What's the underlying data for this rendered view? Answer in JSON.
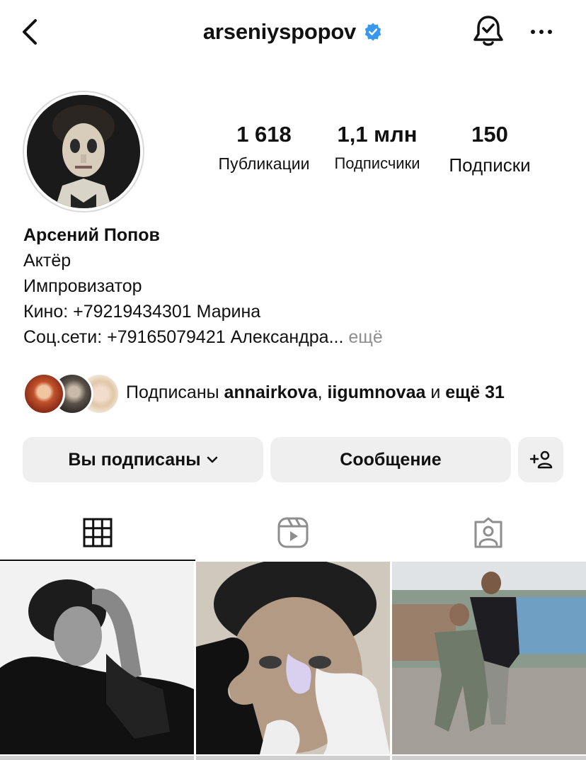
{
  "header": {
    "username": "arseniyspopov",
    "back_icon": "chevron-left-icon",
    "verified_icon": "verified-badge-icon",
    "notify_icon": "bell-check-icon",
    "more_icon": "more-horizontal-icon"
  },
  "stats": [
    {
      "value": "1 618",
      "label": "Публикации"
    },
    {
      "value": "1,1 млн",
      "label": "Подписчики"
    },
    {
      "value": "150",
      "label": "Подписки"
    }
  ],
  "bio": {
    "name": "Арсений Попов",
    "lines": [
      "Актёр",
      "Импровизатор",
      "Кино: +79219434301 Марина",
      "Соц.сети: +79165079421 Александра..."
    ],
    "more": "ещё"
  },
  "followed_by": {
    "prefix": "Подписаны",
    "user1": "annairkova",
    "separator": ",",
    "user2": "iigumnovaa",
    "conjunction": "и",
    "others": "ещё 31"
  },
  "actions": {
    "following_label": "Вы подписаны",
    "message_label": "Сообщение",
    "add_person_icon": "add-person-icon"
  },
  "tabs": [
    {
      "icon": "grid-icon",
      "active": true
    },
    {
      "icon": "reels-icon",
      "active": false
    },
    {
      "icon": "tagged-icon",
      "active": false
    }
  ],
  "colors": {
    "verified": "#3897f0",
    "button_bg": "#efefef",
    "muted": "#8e8e8e"
  }
}
